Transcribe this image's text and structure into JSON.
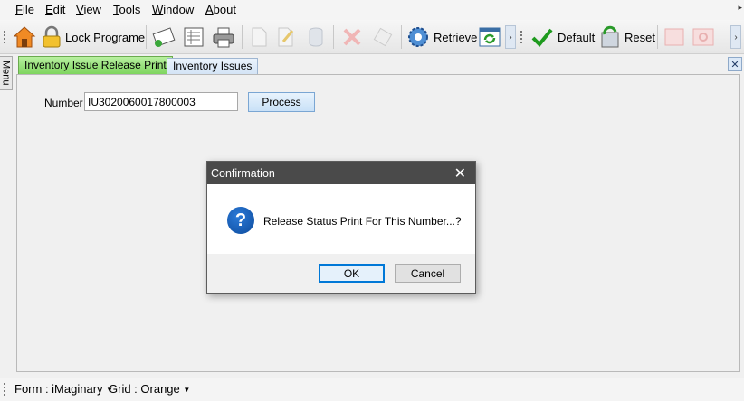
{
  "menubar": {
    "items": [
      {
        "key": "F",
        "rest": "ile"
      },
      {
        "key": "E",
        "rest": "dit"
      },
      {
        "key": "V",
        "rest": "iew"
      },
      {
        "key": "T",
        "rest": "ools"
      },
      {
        "key": "W",
        "rest": "indow"
      },
      {
        "key": "A",
        "rest": "bout"
      }
    ]
  },
  "toolbar": {
    "lock_label": "Lock Programe",
    "retrieve_label": "Retrieve",
    "default_label": "Default",
    "reset_label": "Reset"
  },
  "side_menu_label": "Menu",
  "tabs": [
    {
      "label": "Inventory Issue Release Print"
    },
    {
      "label": "Inventory Issues"
    }
  ],
  "form": {
    "number_label": "Number",
    "number_value": "IU3020060017800003",
    "process_label": "Process"
  },
  "dialog": {
    "title": "Confirmation",
    "message": "Release Status Print For This Number...?",
    "ok_label": "OK",
    "cancel_label": "Cancel"
  },
  "status": {
    "form_label": "Form : iMaginary",
    "grid_label": "Grid : Orange"
  },
  "colors": {
    "active_tab": "#7ed55f",
    "dialog_title": "#4a4a4a",
    "ok_border": "#0078d7"
  }
}
